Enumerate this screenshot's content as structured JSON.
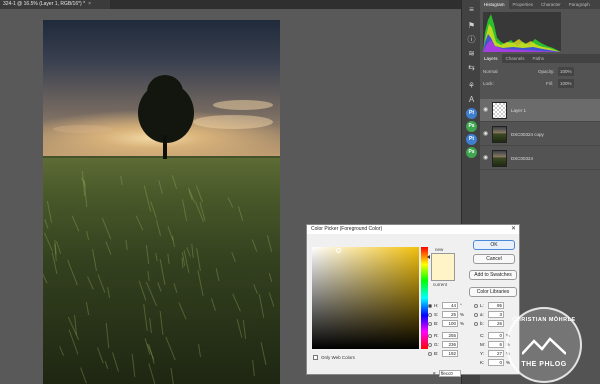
{
  "document_tab": {
    "title": "324-1 @ 16.5% (Layer 1, RGB/16*) *",
    "close": "×"
  },
  "panels": {
    "top_tabs": [
      "Histogram",
      "Properties",
      "Character",
      "Paragraph"
    ],
    "layer_tabs": [
      "Layers",
      "Channels",
      "Paths"
    ],
    "layer_options": {
      "mode": "Normal",
      "opacity_label": "Opacity:",
      "opacity": "100%",
      "lock_label": "Lock:",
      "fill_label": "Fill:",
      "fill": "100%"
    },
    "layers": [
      {
        "name": "Layer 1"
      },
      {
        "name": "DSC00324 copy"
      },
      {
        "name": "DSC00324"
      }
    ]
  },
  "tools": [
    "≡",
    "⚑",
    "ⓘ",
    "≋",
    "⇆",
    "◉",
    "◨",
    "⚘",
    "A",
    "¶",
    "Pt",
    "Ps",
    "Pt",
    "Ps"
  ],
  "color_picker": {
    "title": "Color Picker (Foreground Color)",
    "close": "✕",
    "new_label": "new",
    "current_label": "current",
    "new_color": "#fff3c8",
    "buttons": {
      "ok": "OK",
      "cancel": "Cancel",
      "add_swatches": "Add to Swatches",
      "libraries": "Color Libraries"
    },
    "hsb": [
      {
        "label": "H:",
        "value": "44",
        "unit": "°"
      },
      {
        "label": "S:",
        "value": "25",
        "unit": "%"
      },
      {
        "label": "B:",
        "value": "100",
        "unit": "%"
      }
    ],
    "rgb": [
      {
        "label": "R:",
        "value": "255",
        "unit": ""
      },
      {
        "label": "G:",
        "value": "236",
        "unit": ""
      },
      {
        "label": "B:",
        "value": "192",
        "unit": ""
      }
    ],
    "lab": [
      {
        "label": "L:",
        "value": "95",
        "unit": ""
      },
      {
        "label": "a:",
        "value": "3",
        "unit": ""
      },
      {
        "label": "b:",
        "value": "26",
        "unit": ""
      }
    ],
    "cmyk": [
      {
        "label": "C:",
        "value": "0",
        "unit": "%"
      },
      {
        "label": "M:",
        "value": "6",
        "unit": "%"
      },
      {
        "label": "Y:",
        "value": "27",
        "unit": "%"
      },
      {
        "label": "K:",
        "value": "0",
        "unit": "%"
      }
    ],
    "hex_label": "#",
    "hex": "ffecc0",
    "web_only_label": "Only Web Colors"
  },
  "watermark": {
    "top": "CHRISTIAN MÖHRLE",
    "bottom": "THE PHLOG"
  }
}
